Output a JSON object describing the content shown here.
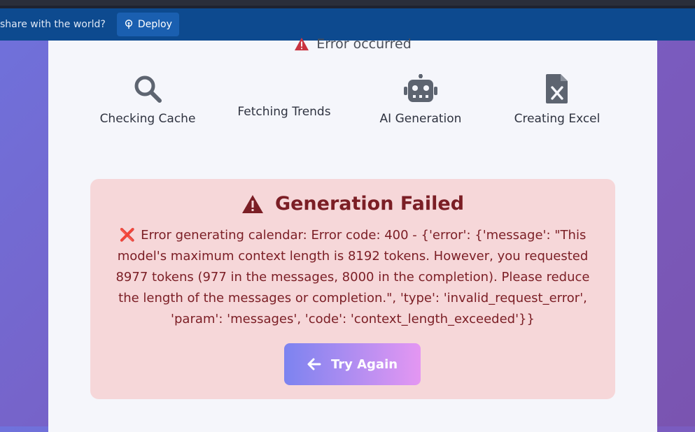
{
  "banner": {
    "text": "share with the world?",
    "deploy_label": "Deploy"
  },
  "status": {
    "text": "Error occurred"
  },
  "steps": [
    {
      "label": "Checking Cache",
      "icon": "search-icon"
    },
    {
      "label": "Fetching Trends",
      "icon": ""
    },
    {
      "label": "AI Generation",
      "icon": "robot-icon"
    },
    {
      "label": "Creating Excel",
      "icon": "excel-file-icon"
    }
  ],
  "error_box": {
    "title": "Generation Failed",
    "icon_x": "❌",
    "message": "Error generating calendar: Error code: 400 - {'error': {'message': \"This model's maximum context length is 8192 tokens. However, you requested 8977 tokens (977 in the messages, 8000 in the completion). Please reduce the length of the messages or completion.\", 'type': 'invalid_request_error', 'param': 'messages', 'code': 'context_length_exceeded'}}",
    "retry_label": "Try Again"
  },
  "colors": {
    "banner_bg": "#0d4a8f",
    "error_text": "#7b1e25",
    "error_bg": "#f6d7d9",
    "warning_red": "#c9333f",
    "icon_gray": "#5d6470",
    "button_gradient_start": "#7c83f0",
    "button_gradient_end": "#e497f2"
  }
}
